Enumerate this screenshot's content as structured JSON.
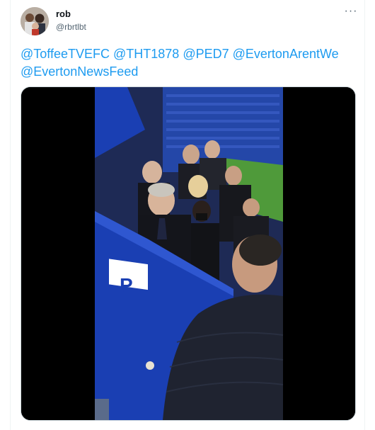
{
  "tweet": {
    "author": {
      "display_name": "rob",
      "handle": "@rbrtlbt"
    },
    "more_icon": "more-dots-icon",
    "mentions": [
      "@ToffeeTVEFC",
      "@THT1878",
      "@PED7",
      "@EvertonArentWe",
      "@EvertonNewsFeed"
    ],
    "media": {
      "type": "video",
      "sign_text": "P"
    }
  },
  "colors": {
    "link": "#1d9bf0",
    "text": "#0f1419",
    "secondary": "#536471",
    "stand_blue": "#1a3fb3",
    "pitch_green": "#4f9a3a"
  }
}
